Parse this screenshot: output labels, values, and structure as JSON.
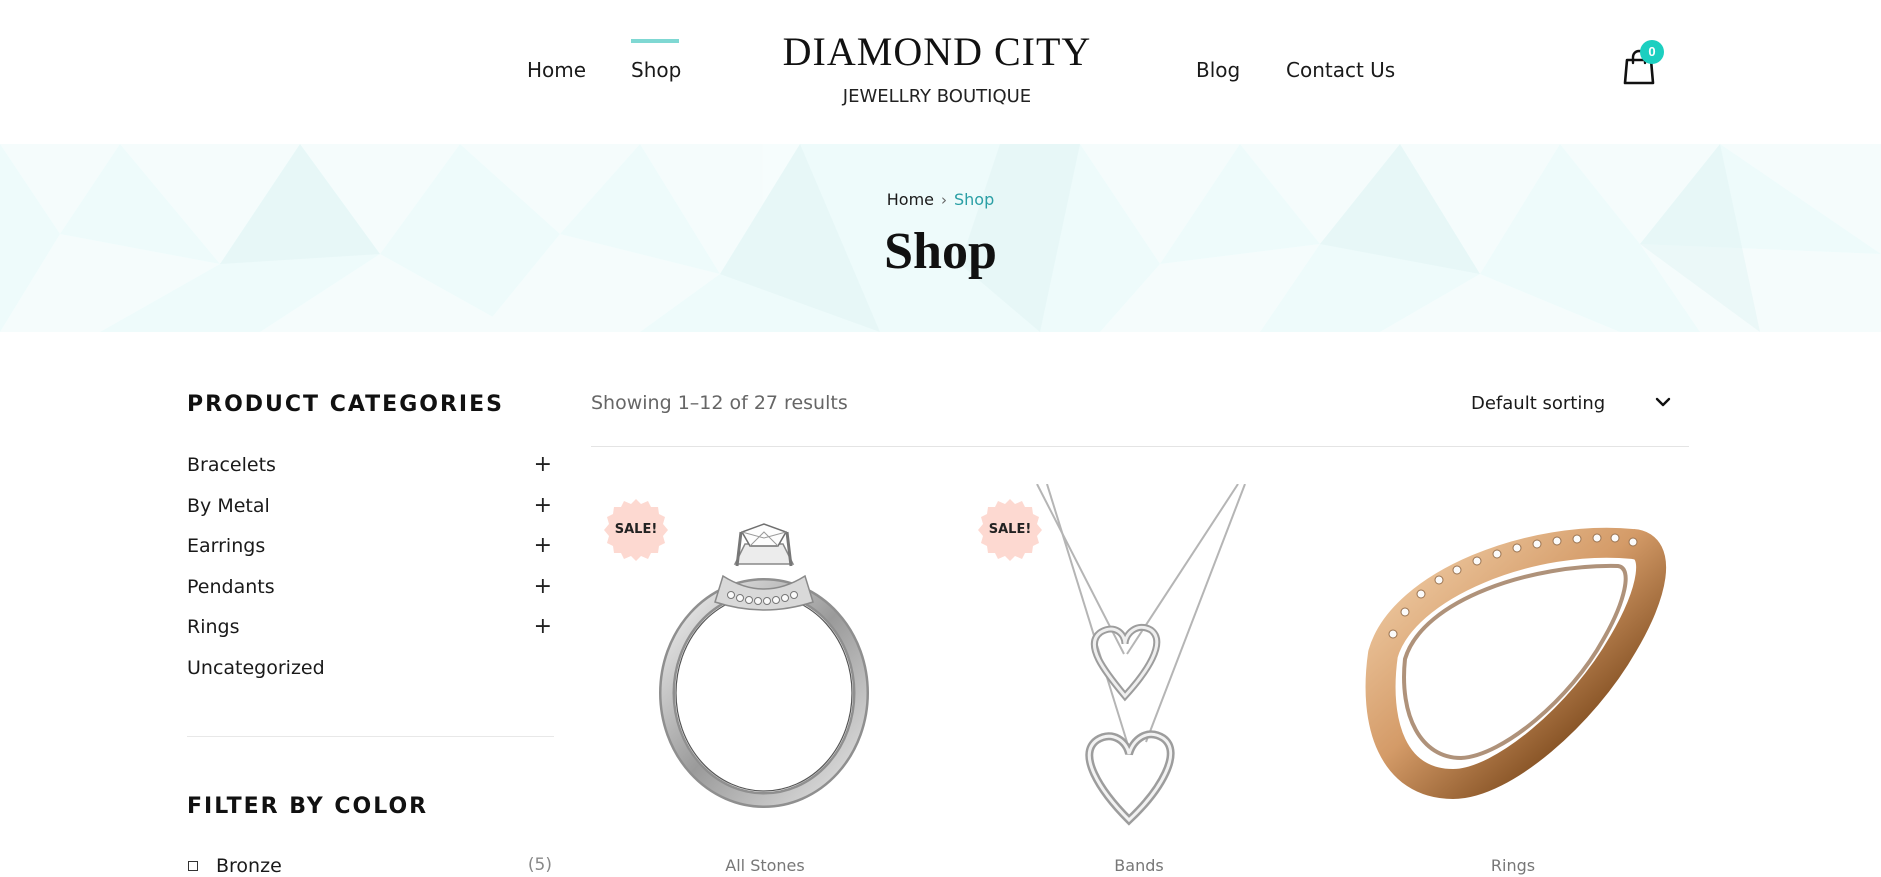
{
  "header": {
    "nav_left": [
      "Home",
      "Shop"
    ],
    "nav_right": [
      "Blog",
      "Contact Us"
    ],
    "active_nav": "Shop",
    "logo_title": "DIAMOND CITY",
    "logo_subtitle": "JEWELLRY BOUTIQUE",
    "cart_count": "0",
    "accent_color": "#1ccfc0"
  },
  "hero": {
    "breadcrumb_home": "Home",
    "breadcrumb_separator": "›",
    "breadcrumb_current": "Shop",
    "title": "Shop",
    "background_color": "#eefbfb"
  },
  "sidebar": {
    "categories_title": "PRODUCT CATEGORIES",
    "categories": [
      {
        "label": "Bracelets",
        "expandable": true
      },
      {
        "label": "By Metal",
        "expandable": true
      },
      {
        "label": "Earrings",
        "expandable": true
      },
      {
        "label": "Pendants",
        "expandable": true
      },
      {
        "label": "Rings",
        "expandable": true
      },
      {
        "label": "Uncategorized",
        "expandable": false
      }
    ],
    "expand_symbol": "+",
    "color_filter_title": "FILTER BY COLOR",
    "colors": [
      {
        "label": "Bronze",
        "count": "(5)"
      }
    ]
  },
  "main": {
    "result_count": "Showing 1–12 of 27 results",
    "sort_selected": "Default sorting",
    "products": [
      {
        "category": "All Stones",
        "sale_badge": "SALE!",
        "icon": "diamond-ring-icon"
      },
      {
        "category": "Bands",
        "sale_badge": "SALE!",
        "icon": "heart-pendant-necklace-icon"
      },
      {
        "category": "Rings",
        "sale_badge": "",
        "icon": "gold-band-ring-icon"
      }
    ],
    "sale_badge_color": "#fdd9d1"
  }
}
